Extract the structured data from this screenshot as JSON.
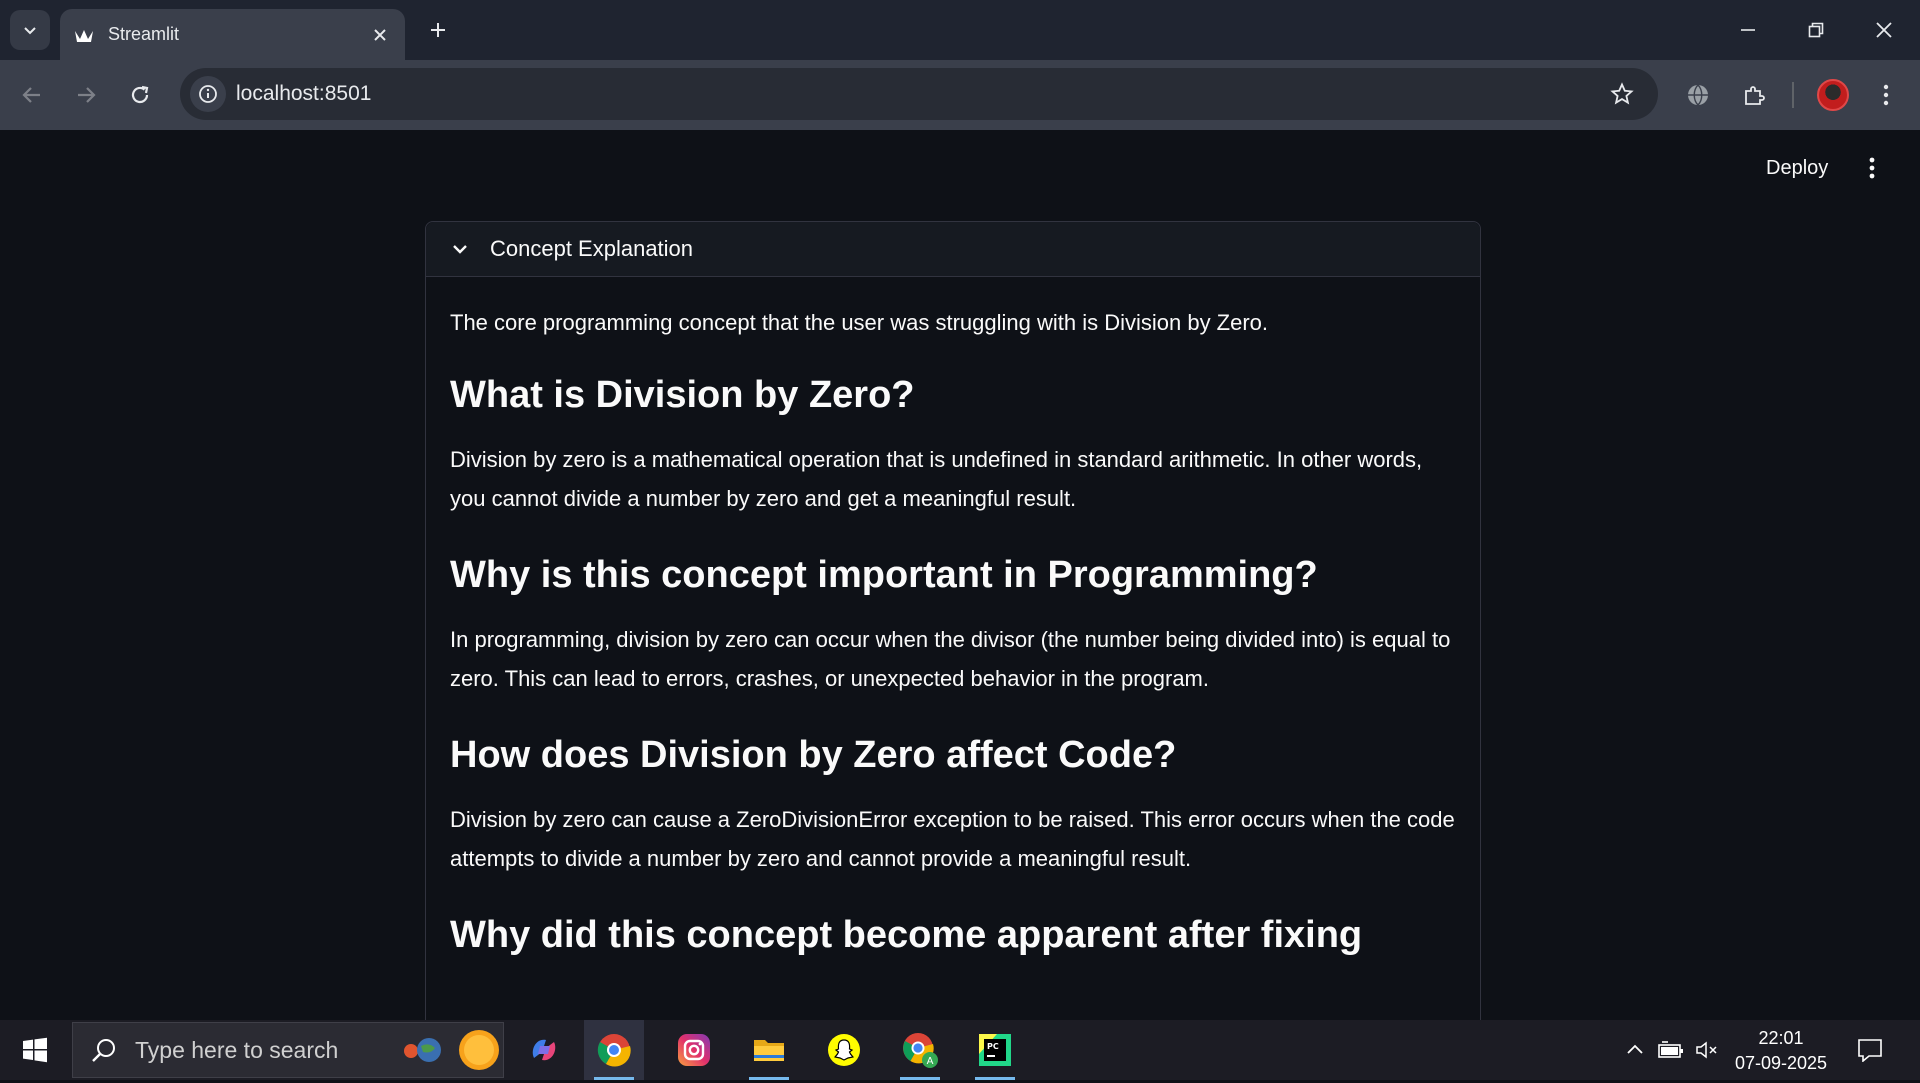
{
  "browser": {
    "tab_title": "Streamlit",
    "url": "localhost:8501"
  },
  "app": {
    "deploy_label": "Deploy",
    "expander": {
      "title": "Concept Explanation",
      "content": [
        {
          "type": "p",
          "text": "The core programming concept that the user was struggling with is Division by Zero."
        },
        {
          "type": "h",
          "text": "What is Division by Zero?"
        },
        {
          "type": "p",
          "text": "Division by zero is a mathematical operation that is undefined in standard arithmetic. In other words, you cannot divide a number by zero and get a meaningful result."
        },
        {
          "type": "h",
          "text": "Why is this concept important in Programming?"
        },
        {
          "type": "p",
          "text": "In programming, division by zero can occur when the divisor (the number being divided into) is equal to zero. This can lead to errors, crashes, or unexpected behavior in the program."
        },
        {
          "type": "h",
          "text": "How does Division by Zero affect Code?"
        },
        {
          "type": "p",
          "text": "Division by zero can cause a ZeroDivisionError exception to be raised. This error occurs when the code attempts to divide a number by zero and cannot provide a meaningful result."
        },
        {
          "type": "h",
          "text": "Why did this concept become apparent after fixing"
        }
      ]
    }
  },
  "taskbar": {
    "search_placeholder": "Type here to search",
    "time": "22:01",
    "date": "07-09-2025",
    "apps": [
      "copilot-icon",
      "chrome-icon",
      "instagram-icon",
      "file-explorer-icon",
      "snapchat-icon",
      "chrome-profile-icon",
      "pycharm-icon"
    ]
  },
  "colors": {
    "app_background": "#0e1117",
    "expander_border": "#31333f",
    "toolbar": "#3a3f4b",
    "taskbar": "#1c1c24"
  }
}
